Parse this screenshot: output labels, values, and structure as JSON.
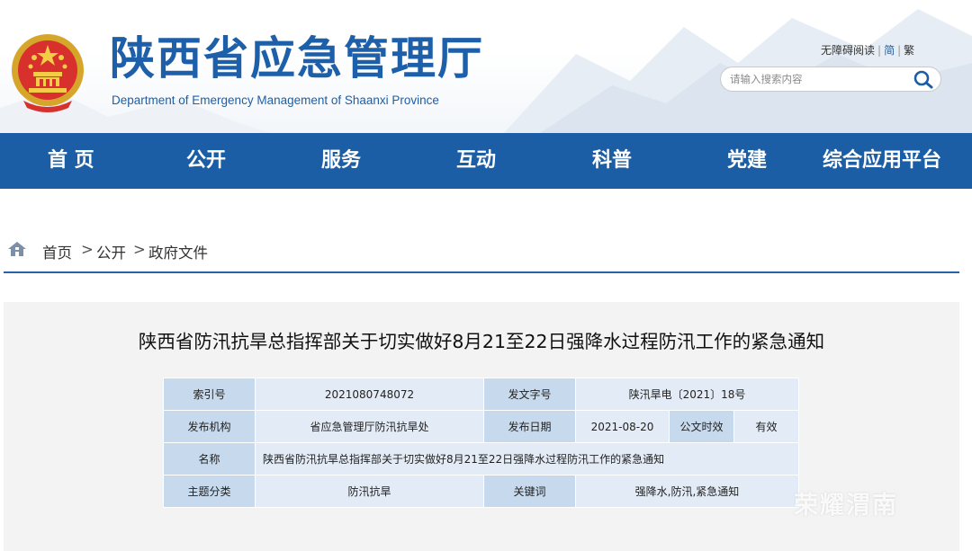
{
  "header": {
    "title": "陕西省应急管理厅",
    "subtitle": "Department of Emergency Management of Shaanxi Province",
    "accessibility_link": "无障碍阅读",
    "simplified_link": "简",
    "traditional_link": "繁",
    "separator": "|",
    "search_placeholder": "请输入搜索内容",
    "search_icon": "search-icon",
    "emblem_icon": "national-emblem-icon"
  },
  "nav": {
    "items": [
      "首 页",
      "公开",
      "服务",
      "互动",
      "科普",
      "党建",
      "综合应用平台"
    ]
  },
  "breadcrumb": {
    "home_icon": "home-icon",
    "items": [
      "首页",
      "公开",
      "政府文件"
    ],
    "separator": ">"
  },
  "document": {
    "title": "陕西省防汛抗旱总指挥部关于切实做好8月21至22日强降水过程防汛工作的紧急通知",
    "meta": {
      "index_label": "索引号",
      "index_value": "2021080748072",
      "doc_number_label": "发文字号",
      "doc_number_value": "陕汛旱电〔2021〕18号",
      "publisher_label": "发布机构",
      "publisher_value": "省应急管理厅防汛抗旱处",
      "date_label": "发布日期",
      "date_value": "2021-08-20",
      "validity_label": "公文时效",
      "validity_value": "有效",
      "name_label": "名称",
      "name_value": "陕西省防汛抗旱总指挥部关于切实做好8月21至22日强降水过程防汛工作的紧急通知",
      "topic_label": "主题分类",
      "topic_value": "防汛抗旱",
      "keywords_label": "关键词",
      "keywords_value": "强降水,防汛,紧急通知"
    }
  },
  "watermark": "荣耀渭南",
  "colors": {
    "brand_blue": "#1b5ea5",
    "title_blue": "#1d5fa8",
    "table_label_bg": "#c7d9ec",
    "table_value_bg": "#e3ecf6",
    "panel_bg": "#f3f3f3"
  }
}
